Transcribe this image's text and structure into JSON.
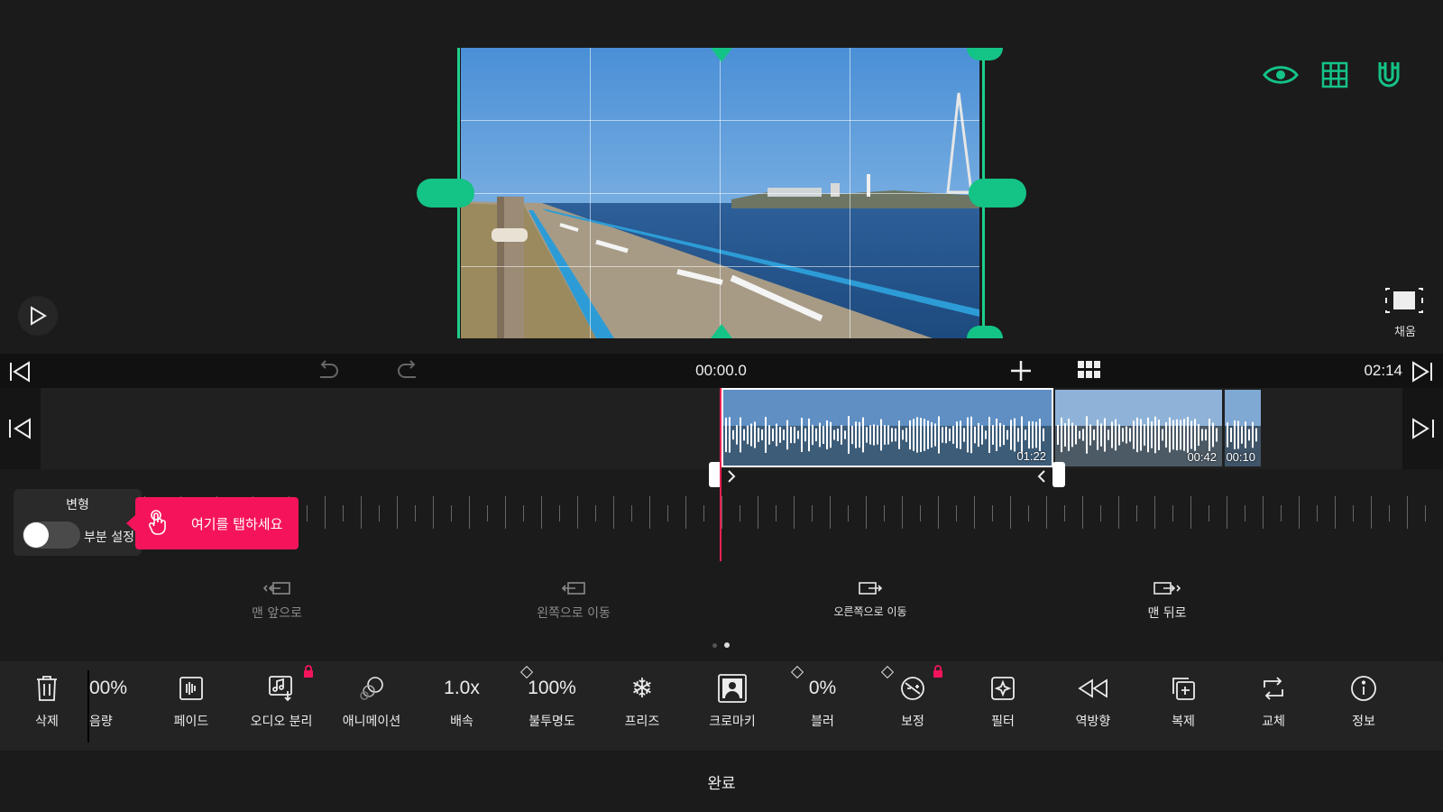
{
  "viewer": {
    "fill_label": "채움"
  },
  "timeline": {
    "current_time": "00:00.0",
    "total_time": "02:14",
    "clips": [
      {
        "duration": "01:22"
      },
      {
        "duration": "00:42"
      },
      {
        "duration": "00:10"
      }
    ]
  },
  "transform_panel": {
    "title": "변형",
    "toggle_label": "부분 설정",
    "toggle_on": false
  },
  "tooltip": {
    "text": "여기를 탭하세요"
  },
  "move_actions": [
    {
      "label": "맨 앞으로",
      "icon": "bring-to-front-icon"
    },
    {
      "label": "왼쪽으로 이동",
      "icon": "move-left-icon"
    },
    {
      "label": "오른쪽으로 이동",
      "icon": "move-right-icon"
    },
    {
      "label": "맨 뒤로",
      "icon": "send-to-back-icon"
    }
  ],
  "tools": [
    {
      "label": "삭제",
      "icon": "trash-icon"
    },
    {
      "label": "음량",
      "value": "00%"
    },
    {
      "label": "페이드",
      "icon": "fade-icon"
    },
    {
      "label": "오디오 분리",
      "icon": "audio-detach-icon",
      "locked": true
    },
    {
      "label": "애니메이션",
      "icon": "animation-icon"
    },
    {
      "label": "배속",
      "value": "1.0x"
    },
    {
      "label": "불투명도",
      "value": "100%",
      "keyframe": true
    },
    {
      "label": "프리즈",
      "icon": "snowflake-icon"
    },
    {
      "label": "크로마키",
      "icon": "chroma-key-icon"
    },
    {
      "label": "블러",
      "value": "0%",
      "keyframe": true
    },
    {
      "label": "보정",
      "icon": "adjust-icon",
      "keyframe": true,
      "locked": true
    },
    {
      "label": "필터",
      "icon": "filter-icon"
    },
    {
      "label": "역방향",
      "icon": "reverse-icon"
    },
    {
      "label": "복제",
      "icon": "duplicate-icon"
    },
    {
      "label": "교체",
      "icon": "replace-icon"
    },
    {
      "label": "정보",
      "icon": "info-icon"
    }
  ],
  "done_label": "완료",
  "colors": {
    "accent_green": "#14c386",
    "tooltip_pink": "#f5145b",
    "playhead": "#e8204f"
  }
}
